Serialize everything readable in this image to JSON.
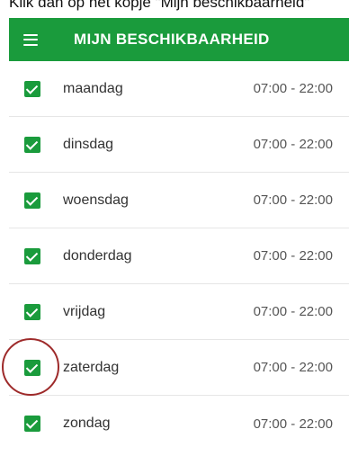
{
  "caption": "Klik dan op het kopje \"Mijn beschikbaarheid\"",
  "header": {
    "title": "MIJN BESCHIKBAARHEID",
    "menu_icon": "hamburger-menu-icon",
    "background": "#1a9b3c"
  },
  "availability": [
    {
      "day": "maandag",
      "checked": true,
      "from": "07:00",
      "sep": "-",
      "to": "22:00"
    },
    {
      "day": "dinsdag",
      "checked": true,
      "from": "07:00",
      "sep": "-",
      "to": "22:00"
    },
    {
      "day": "woensdag",
      "checked": true,
      "from": "07:00",
      "sep": "-",
      "to": "22:00"
    },
    {
      "day": "donderdag",
      "checked": true,
      "from": "07:00",
      "sep": "-",
      "to": "22:00"
    },
    {
      "day": "vrijdag",
      "checked": true,
      "from": "07:00",
      "sep": "-",
      "to": "22:00"
    },
    {
      "day": "zaterdag",
      "checked": true,
      "from": "07:00",
      "sep": "-",
      "to": "22:00"
    },
    {
      "day": "zondag",
      "checked": true,
      "from": "07:00",
      "sep": "-",
      "to": "22:00"
    }
  ],
  "highlight_color": "#9e2a2a"
}
